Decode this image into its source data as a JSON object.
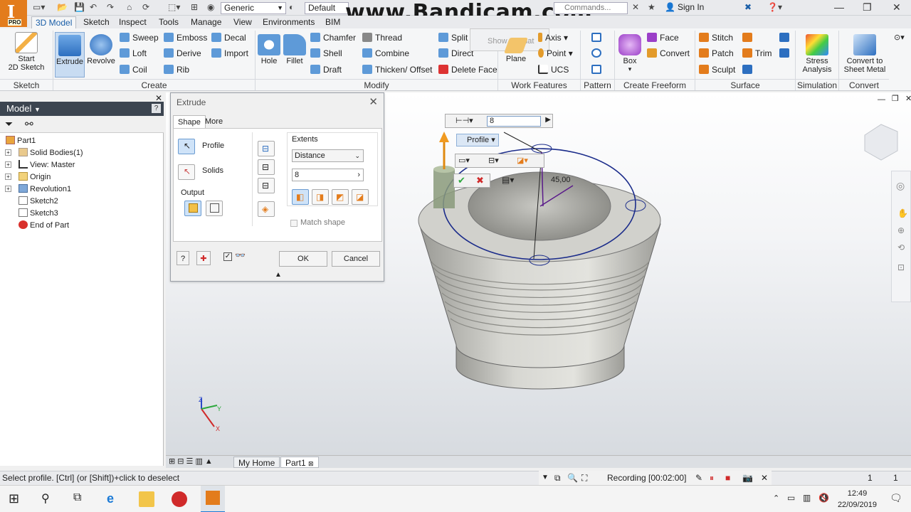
{
  "app": {
    "logo_text": "I",
    "logo_badge": "PRO",
    "watermark": "www.Bandicam.com",
    "style_combo": "Generic",
    "appearance_combo": "Default",
    "search_placeholder": "Commands...",
    "signin_label": "Sign In",
    "show_format_label": "Show Format"
  },
  "tabs": [
    "3D Model",
    "Sketch",
    "Inspect",
    "Tools",
    "Manage",
    "View",
    "Environments",
    "BIM"
  ],
  "active_tab": "3D Model",
  "ribbon": {
    "sketch_panel": {
      "label": "Sketch",
      "start_sketch_line1": "Start",
      "start_sketch_line2": "2D Sketch"
    },
    "create_panel": {
      "label": "Create",
      "extrude": "Extrude",
      "revolve": "Revolve",
      "sweep": "Sweep",
      "loft": "Loft",
      "coil": "Coil",
      "emboss": "Emboss",
      "derive": "Derive",
      "rib": "Rib",
      "decal": "Decal",
      "import": "Import"
    },
    "modify_panel": {
      "label": "Modify",
      "hole": "Hole",
      "fillet": "Fillet",
      "chamfer": "Chamfer",
      "shell": "Shell",
      "draft": "Draft",
      "thread": "Thread",
      "combine": "Combine",
      "thicken": "Thicken/ Offset",
      "split": "Split",
      "direct": "Direct",
      "delete_face": "Delete Face"
    },
    "work_features_panel": {
      "label": "Work Features",
      "plane": "Plane",
      "axis": "Axis",
      "point": "Point",
      "ucs": "UCS"
    },
    "pattern_panel": {
      "label": "Pattern"
    },
    "freeform_panel": {
      "label": "Create Freeform",
      "box": "Box",
      "face": "Face",
      "convert": "Convert"
    },
    "surface_panel": {
      "label": "Surface",
      "stitch": "Stitch",
      "patch": "Patch",
      "sculpt": "Sculpt",
      "trim": "Trim"
    },
    "simulation_panel": {
      "label": "Simulation",
      "stress_line1": "Stress",
      "stress_line2": "Analysis"
    },
    "convert_panel": {
      "label": "Convert",
      "sheet_line1": "Convert to",
      "sheet_line2": "Sheet Metal"
    }
  },
  "browser": {
    "title": "Model",
    "items": [
      {
        "label": "Part1"
      },
      {
        "label": "Solid Bodies(1)"
      },
      {
        "label": "View: Master"
      },
      {
        "label": "Origin"
      },
      {
        "label": "Revolution1"
      },
      {
        "label": "Sketch2"
      },
      {
        "label": "Sketch3"
      },
      {
        "label": "End of Part"
      }
    ]
  },
  "dialog": {
    "title": "Extrude",
    "tab_shape": "Shape",
    "tab_more": "More",
    "profile": "Profile",
    "solids": "Solids",
    "output": "Output",
    "extents": "Extents",
    "extents_type": "Distance",
    "distance_value": "8",
    "match_shape": "Match shape",
    "ok": "OK",
    "cancel": "Cancel"
  },
  "viewport": {
    "mini_input_value": "8",
    "profile_label": "Profile",
    "angle_label": "45,00",
    "axis_x": "X",
    "axis_y": "Y",
    "axis_z": "Z"
  },
  "bottom_tabs": {
    "home": "My Home",
    "part": "Part1"
  },
  "status": {
    "prompt": "Select profile. [Ctrl] (or [Shift])+click to deselect",
    "recording": "Recording [00:02:00]",
    "count1": "1",
    "count2": "1"
  },
  "taskbar": {
    "time": "12:49",
    "date": "22/09/2019"
  }
}
